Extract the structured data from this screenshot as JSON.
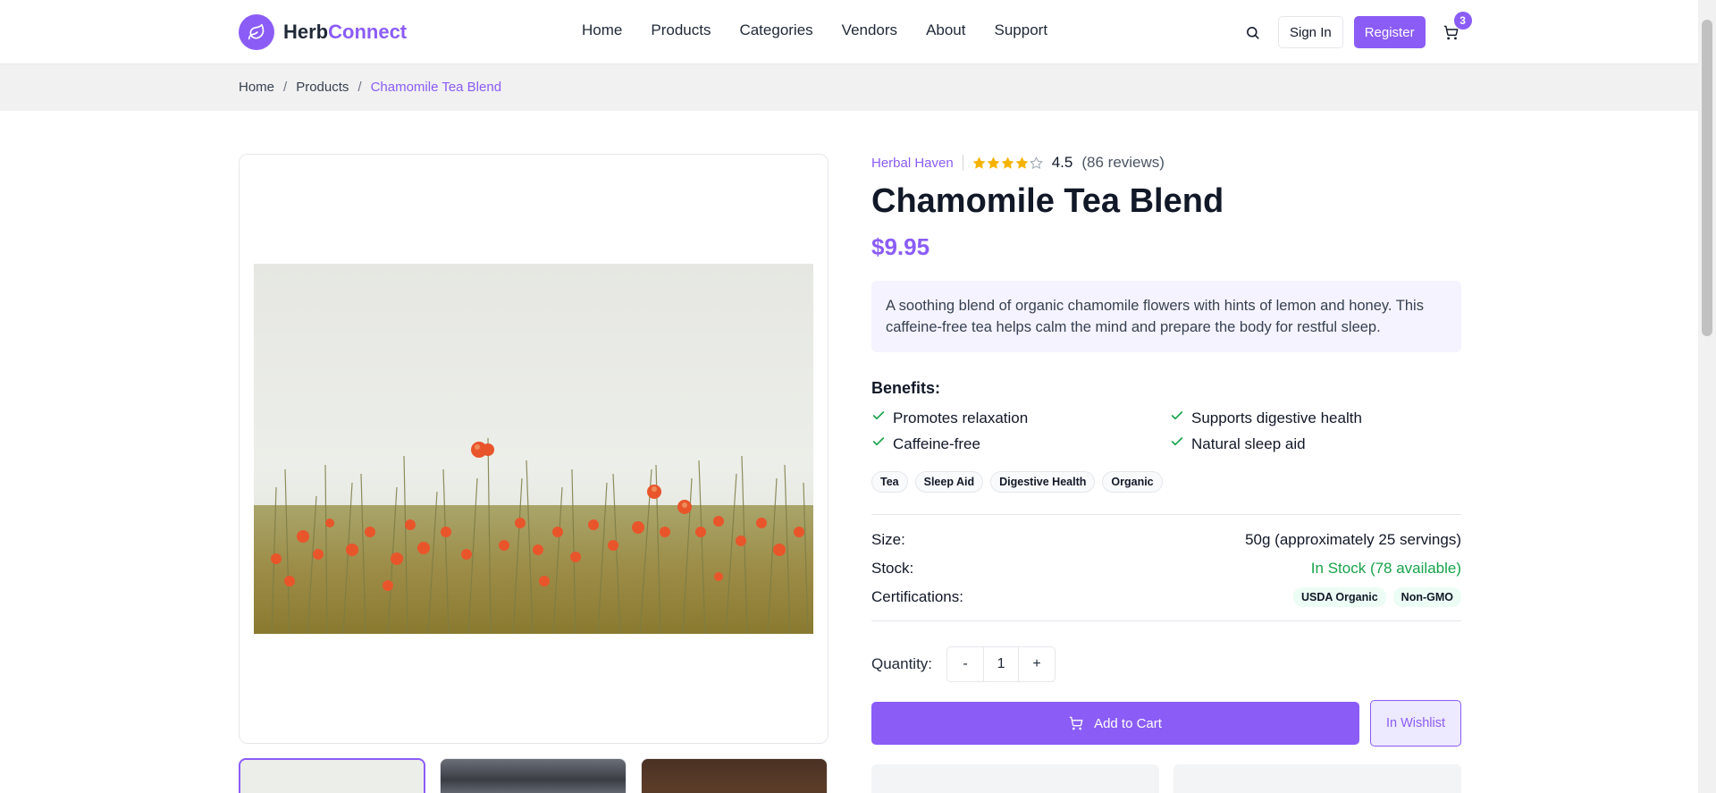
{
  "brand": {
    "part1": "Herb",
    "part2": "Connect",
    "accent": "#8b5cf6"
  },
  "nav": [
    "Home",
    "Products",
    "Categories",
    "Vendors",
    "About",
    "Support"
  ],
  "header": {
    "signin": "Sign In",
    "register": "Register",
    "cart_count": "3"
  },
  "breadcrumb": {
    "home": "Home",
    "products": "Products",
    "current": "Chamomile Tea Blend",
    "sep": "/"
  },
  "product": {
    "vendor": "Herbal Haven",
    "rating": "4.5",
    "reviews": "(86 reviews)",
    "rating_value": 4.5,
    "title": "Chamomile Tea Blend",
    "price": "$9.95",
    "description": "A soothing blend of organic chamomile flowers with hints of lemon and honey. This caffeine-free tea helps calm the mind and prepare the body for restful sleep.",
    "benefits_title": "Benefits:",
    "benefits": [
      "Promotes relaxation",
      "Supports digestive health",
      "Caffeine-free",
      "Natural sleep aid"
    ],
    "tags": [
      "Tea",
      "Sleep Aid",
      "Digestive Health",
      "Organic"
    ],
    "specs": {
      "size_label": "Size:",
      "size": "50g (approximately 25 servings)",
      "stock_label": "Stock:",
      "stock": "In Stock (78 available)",
      "cert_label": "Certifications:",
      "certs": [
        "USDA Organic",
        "Non-GMO"
      ]
    },
    "quantity_label": "Quantity:",
    "quantity": {
      "minus": "-",
      "value": "1",
      "plus": "+"
    },
    "add_to_cart": "Add to Cart",
    "wishlist": "In Wishlist"
  }
}
